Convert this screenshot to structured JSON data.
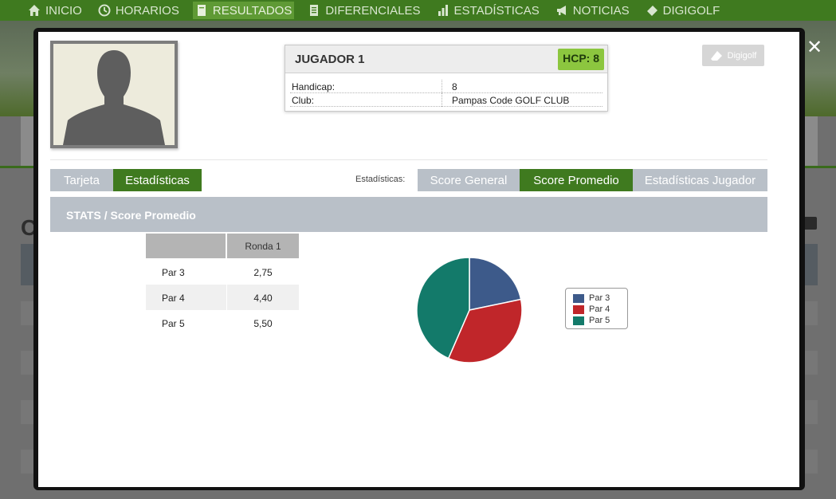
{
  "nav": {
    "items": [
      {
        "label": "INICIO",
        "icon": "home-icon",
        "active": false
      },
      {
        "label": "HORARIOS",
        "icon": "clock-icon",
        "active": false
      },
      {
        "label": "RESULTADOS",
        "icon": "document-icon",
        "active": true
      },
      {
        "label": "DIFERENCIALES",
        "icon": "list-icon",
        "active": false
      },
      {
        "label": "ESTADÍSTICAS",
        "icon": "bar-chart-icon",
        "active": false
      },
      {
        "label": "NOTICIAS",
        "icon": "megaphone-icon",
        "active": false
      },
      {
        "label": "DIGIGOLF",
        "icon": "eraser-icon",
        "active": false
      }
    ]
  },
  "modal": {
    "close_label": "✕",
    "player": {
      "name": "JUGADOR 1",
      "hcp_badge": "HCP: 8",
      "handicap_label": "Handicap:",
      "handicap_value": "8",
      "club_label": "Club:",
      "club_value": "Pampas Code GOLF CLUB"
    },
    "digigolf_label": "Digigolf",
    "view_tabs": [
      {
        "label": "Tarjeta",
        "active": false
      },
      {
        "label": "Estadísticas",
        "active": true
      }
    ],
    "stats_prefix": "Estadísticas:",
    "stats_tabs": [
      {
        "label": "Score General",
        "active": false
      },
      {
        "label": "Score Promedio",
        "active": true
      },
      {
        "label": "Estadísticas Jugador",
        "active": false
      }
    ],
    "section_title": "STATS / Score Promedio",
    "table": {
      "column_header": "Ronda 1",
      "rows": [
        {
          "label": "Par 3",
          "value": "2,75"
        },
        {
          "label": "Par 4",
          "value": "4,40"
        },
        {
          "label": "Par 5",
          "value": "5,50"
        }
      ]
    }
  },
  "colors": {
    "active_green": "#3f7a1f",
    "inactive_tab": "#b9c0c8",
    "hcp_green": "#8cc63f"
  },
  "chart_data": {
    "type": "pie",
    "categories": [
      "Par 3",
      "Par 4",
      "Par 5"
    ],
    "values": [
      2.75,
      4.4,
      5.5
    ],
    "colors": [
      "#3d5a8a",
      "#c0262a",
      "#137a6a"
    ],
    "legend": "right"
  }
}
